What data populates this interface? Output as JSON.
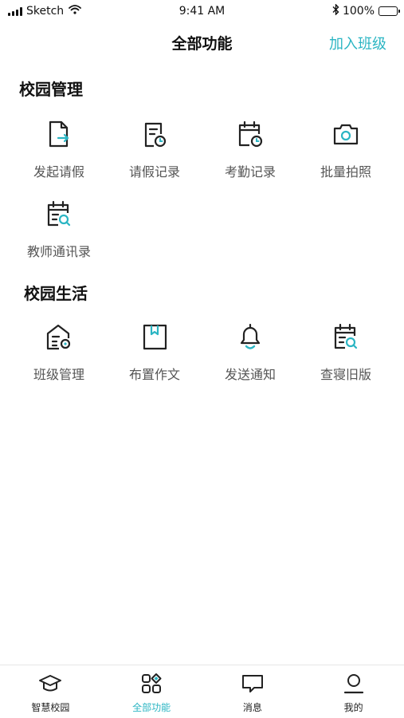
{
  "status_bar": {
    "carrier": "Sketch",
    "time": "9:41 AM",
    "battery": "100%"
  },
  "nav": {
    "title": "全部功能",
    "action": "加入班级"
  },
  "accent_color": "#2bb5c3",
  "sections": [
    {
      "title": "校园管理",
      "items": [
        {
          "label": "发起请假",
          "icon": "document-arrow-icon"
        },
        {
          "label": "请假记录",
          "icon": "document-clock-icon"
        },
        {
          "label": "考勤记录",
          "icon": "calendar-clock-icon"
        },
        {
          "label": "批量拍照",
          "icon": "camera-icon"
        },
        {
          "label": "教师通讯录",
          "icon": "calendar-search-icon"
        }
      ]
    },
    {
      "title": "校园生活",
      "items": [
        {
          "label": "班级管理",
          "icon": "house-gear-icon"
        },
        {
          "label": "布置作文",
          "icon": "bookmark-book-icon"
        },
        {
          "label": "发送通知",
          "icon": "bell-icon"
        },
        {
          "label": "查寝旧版",
          "icon": "calendar-search-icon"
        }
      ]
    }
  ],
  "tabbar": [
    {
      "label": "智慧校园",
      "icon": "graduation-cap-icon",
      "active": false
    },
    {
      "label": "全部功能",
      "icon": "grid-apps-icon",
      "active": true
    },
    {
      "label": "消息",
      "icon": "chat-bubble-icon",
      "active": false
    },
    {
      "label": "我的",
      "icon": "user-icon",
      "active": false
    }
  ]
}
